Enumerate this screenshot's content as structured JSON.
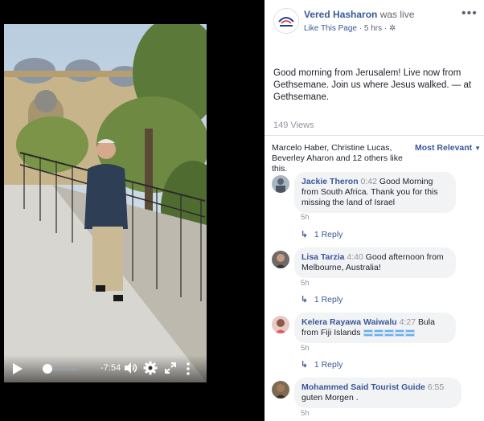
{
  "video": {
    "time_remaining": "-7:54",
    "progress": 0.13
  },
  "post": {
    "page_name": "Vered Hasharon",
    "live_status": "was live",
    "like_page": "Like This Page",
    "time_ago": "5 hrs",
    "options_icon": "ellipsis-icon",
    "text": "Good morning from Jerusalem! Live now from Gethsemane. Join us where Jesus walked. — at Gethsemane.",
    "views": "149 Views",
    "likers": "Marcelo Haber, Christine Lucas, Beverley Aharon and 12 others like this.",
    "sort_label": "Most Relevant"
  },
  "comments": [
    {
      "author": "Jackie Theron",
      "time": "0:42",
      "text": "Good Morning from South Africa. Thank you for this missing the land of Israel",
      "age": "5h",
      "reply_label": "1 Reply"
    },
    {
      "author": "Lisa Tarzia",
      "time": "4:40",
      "text": "Good afternoon from Melbourne, Australia!",
      "age": "5h",
      "reply_label": "1 Reply"
    },
    {
      "author": "Kelera Rayawa Waiwalu",
      "time": "4:27",
      "text": "Bula from Fiji Islands",
      "flags": 5,
      "age": "5h",
      "reply_label": "1 Reply"
    },
    {
      "author": "Mohammed Said Tourist Guide",
      "time": "6:55",
      "text": "guten Morgen .",
      "age": "5h"
    }
  ],
  "colors": {
    "link": "#385898",
    "secondary": "#606770",
    "bubble": "#f2f3f5"
  }
}
